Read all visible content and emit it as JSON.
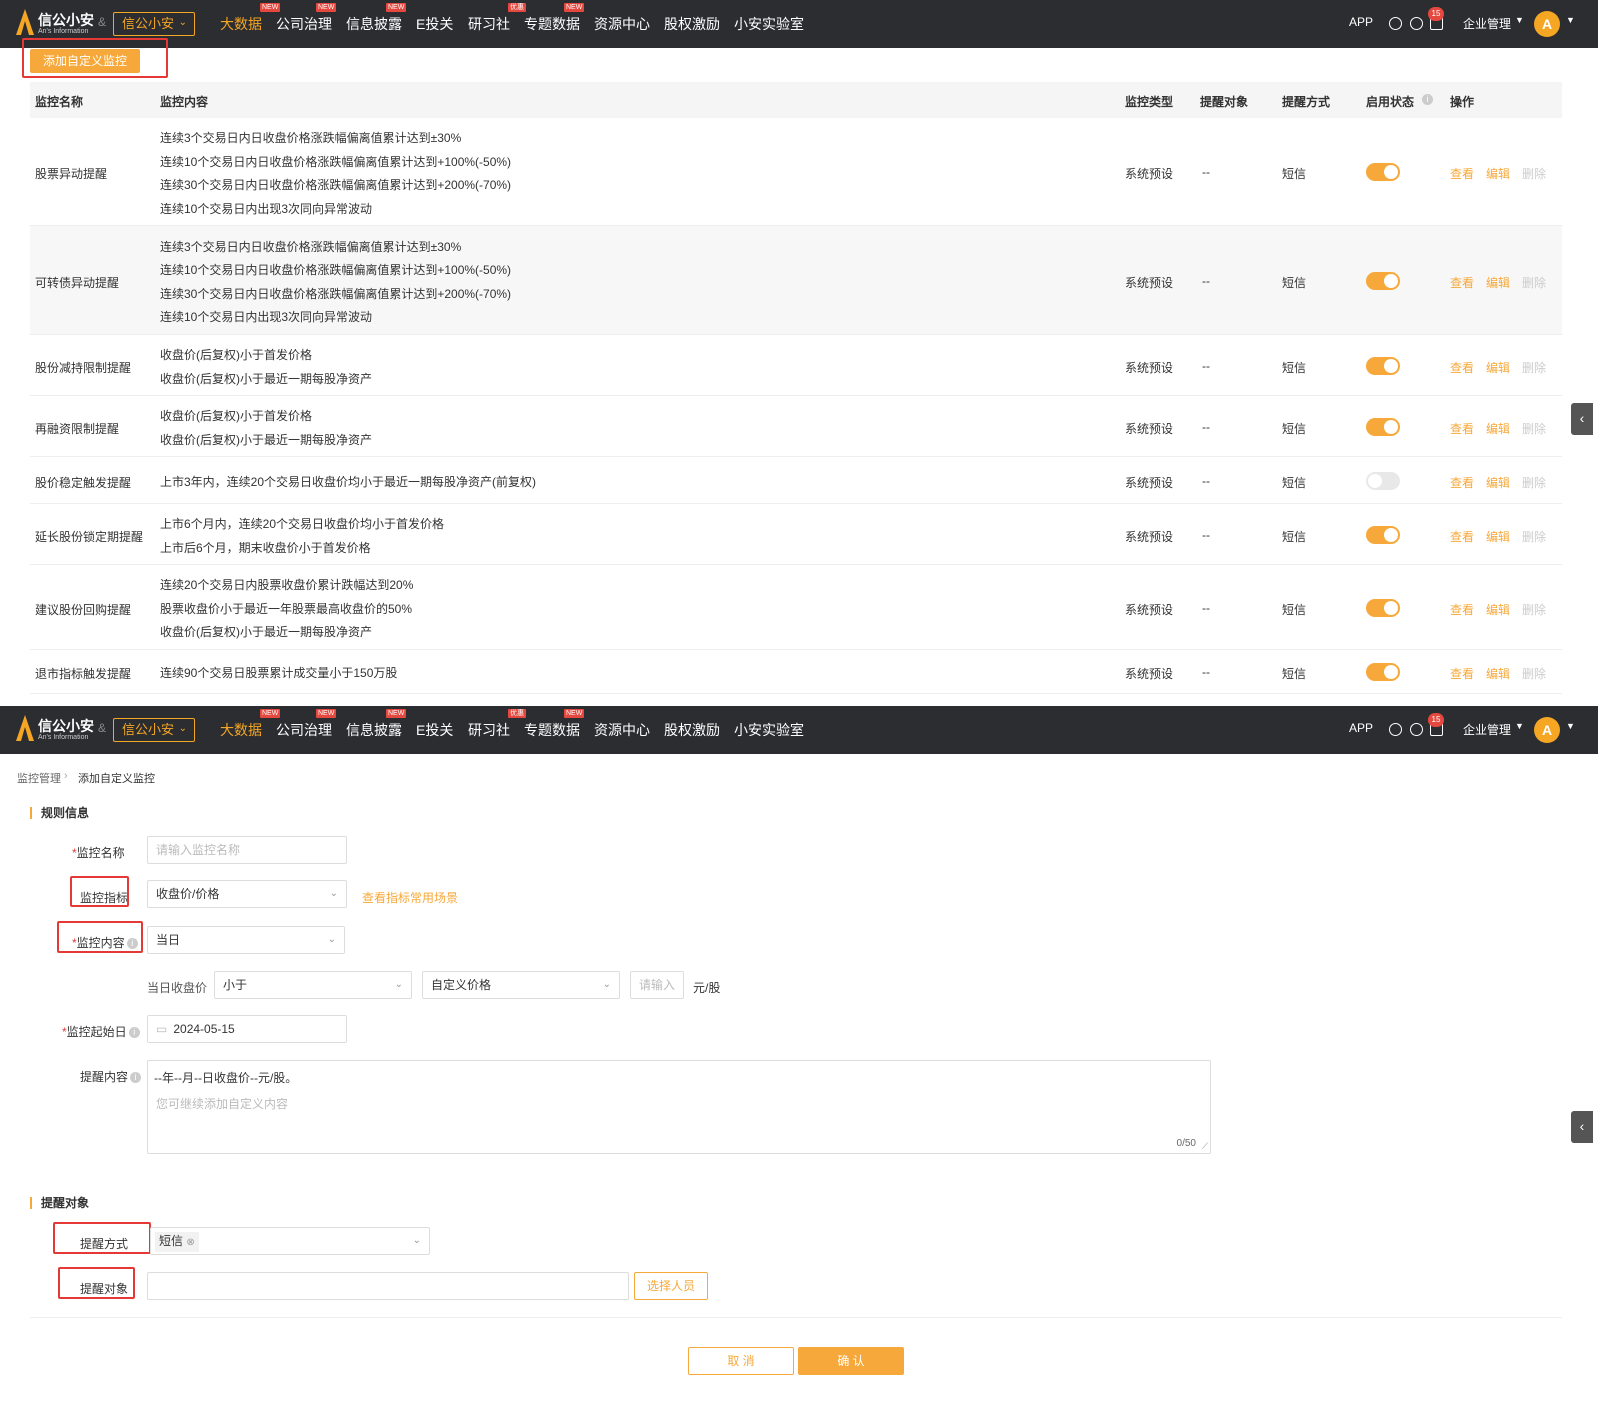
{
  "colors": {
    "accent": "#f7a83a",
    "topbar": "#2c2d31",
    "danger": "#e53935"
  },
  "topbar": {
    "brand_name": "信公小安",
    "brand_sub": "An's Information",
    "amp": "&",
    "brand_select": "信公小安",
    "nav": [
      {
        "label": "大数据",
        "badge": "NEW"
      },
      {
        "label": "公司治理",
        "badge": "NEW"
      },
      {
        "label": "信息披露",
        "badge": "NEW"
      },
      {
        "label": "E投关",
        "badge": ""
      },
      {
        "label": "研习社",
        "badge": "优惠"
      },
      {
        "label": "专题数据",
        "badge": "NEW"
      },
      {
        "label": "资源中心",
        "badge": ""
      },
      {
        "label": "股权激励",
        "badge": ""
      },
      {
        "label": "小安实验室",
        "badge": ""
      }
    ],
    "app": "APP",
    "notif_count": "15",
    "enterprise": "企业管理",
    "avatar_letter": "A"
  },
  "list_page": {
    "add_button": "添加自定义监控",
    "columns": [
      "监控名称",
      "监控内容",
      "监控类型",
      "提醒对象",
      "提醒方式",
      "启用状态",
      "操作"
    ],
    "actions": {
      "view": "查看",
      "edit": "编辑",
      "delete": "删除"
    },
    "rows": [
      {
        "name": "股票异动提醒",
        "content": [
          "连续3个交易日内日收盘价格涨跌幅偏离值累计达到±30%",
          "连续10个交易日内日收盘价格涨跌幅偏离值累计达到+100%(-50%)",
          "连续30个交易日内日收盘价格涨跌幅偏离值累计达到+200%(-70%)",
          "连续10个交易日内出现3次同向异常波动"
        ],
        "type": "系统预设",
        "target": "--",
        "method": "短信",
        "enabled": true
      },
      {
        "name": "可转债异动提醒",
        "content": [
          "连续3个交易日内日收盘价格涨跌幅偏离值累计达到±30%",
          "连续10个交易日内日收盘价格涨跌幅偏离值累计达到+100%(-50%)",
          "连续30个交易日内日收盘价格涨跌幅偏离值累计达到+200%(-70%)",
          "连续10个交易日内出现3次同向异常波动"
        ],
        "type": "系统预设",
        "target": "--",
        "method": "短信",
        "enabled": true
      },
      {
        "name": "股份减持限制提醒",
        "content": [
          "收盘价(后复权)小于首发价格",
          "收盘价(后复权)小于最近一期每股净资产"
        ],
        "type": "系统预设",
        "target": "--",
        "method": "短信",
        "enabled": true
      },
      {
        "name": "再融资限制提醒",
        "content": [
          "收盘价(后复权)小于首发价格",
          "收盘价(后复权)小于最近一期每股净资产"
        ],
        "type": "系统预设",
        "target": "--",
        "method": "短信",
        "enabled": true
      },
      {
        "name": "股价稳定触发提醒",
        "content": [
          "上市3年内，连续20个交易日收盘价均小于最近一期每股净资产(前复权)"
        ],
        "type": "系统预设",
        "target": "--",
        "method": "短信",
        "enabled": false
      },
      {
        "name": "延长股份锁定期提醒",
        "content": [
          "上市6个月内，连续20个交易日收盘价均小于首发价格",
          "上市后6个月，期末收盘价小于首发价格"
        ],
        "type": "系统预设",
        "target": "--",
        "method": "短信",
        "enabled": true
      },
      {
        "name": "建议股份回购提醒",
        "content": [
          "连续20个交易日内股票收盘价累计跌幅达到20%",
          "股票收盘价小于最近一年股票最高收盘价的50%",
          "收盘价(后复权)小于最近一期每股净资产"
        ],
        "type": "系统预设",
        "target": "--",
        "method": "短信",
        "enabled": true
      },
      {
        "name": "退市指标触发提醒",
        "content": [
          "连续90个交易日股票累计成交量小于150万股"
        ],
        "type": "系统预设",
        "target": "--",
        "method": "短信",
        "enabled": true
      }
    ]
  },
  "form_page": {
    "breadcrumb": [
      "监控管理",
      "添加自定义监控"
    ],
    "section_rule": "规则信息",
    "name_label": "监控名称",
    "name_placeholder": "请输入监控名称",
    "indicator_label": "监控指标",
    "indicator_value": "收盘价/价格",
    "indicator_link": "查看指标常用场景",
    "content_label": "监控内容",
    "content_value": "当日",
    "cond_prefix": "当日收盘价",
    "cond_op": "小于",
    "cond_type": "自定义价格",
    "cond_placeholder": "请输入",
    "cond_unit": "元/股",
    "start_label": "监控起始日",
    "start_value": "2024-05-15",
    "remind_label": "提醒内容",
    "remind_text": "--年--月--日收盘价--元/股。",
    "remind_placeholder": "您可继续添加自定义内容",
    "remind_count": "0/50",
    "section_target": "提醒对象",
    "method_label": "提醒方式",
    "method_tag": "短信",
    "target_label": "提醒对象",
    "select_people": "选择人员",
    "cancel": "取 消",
    "confirm": "确 认"
  }
}
